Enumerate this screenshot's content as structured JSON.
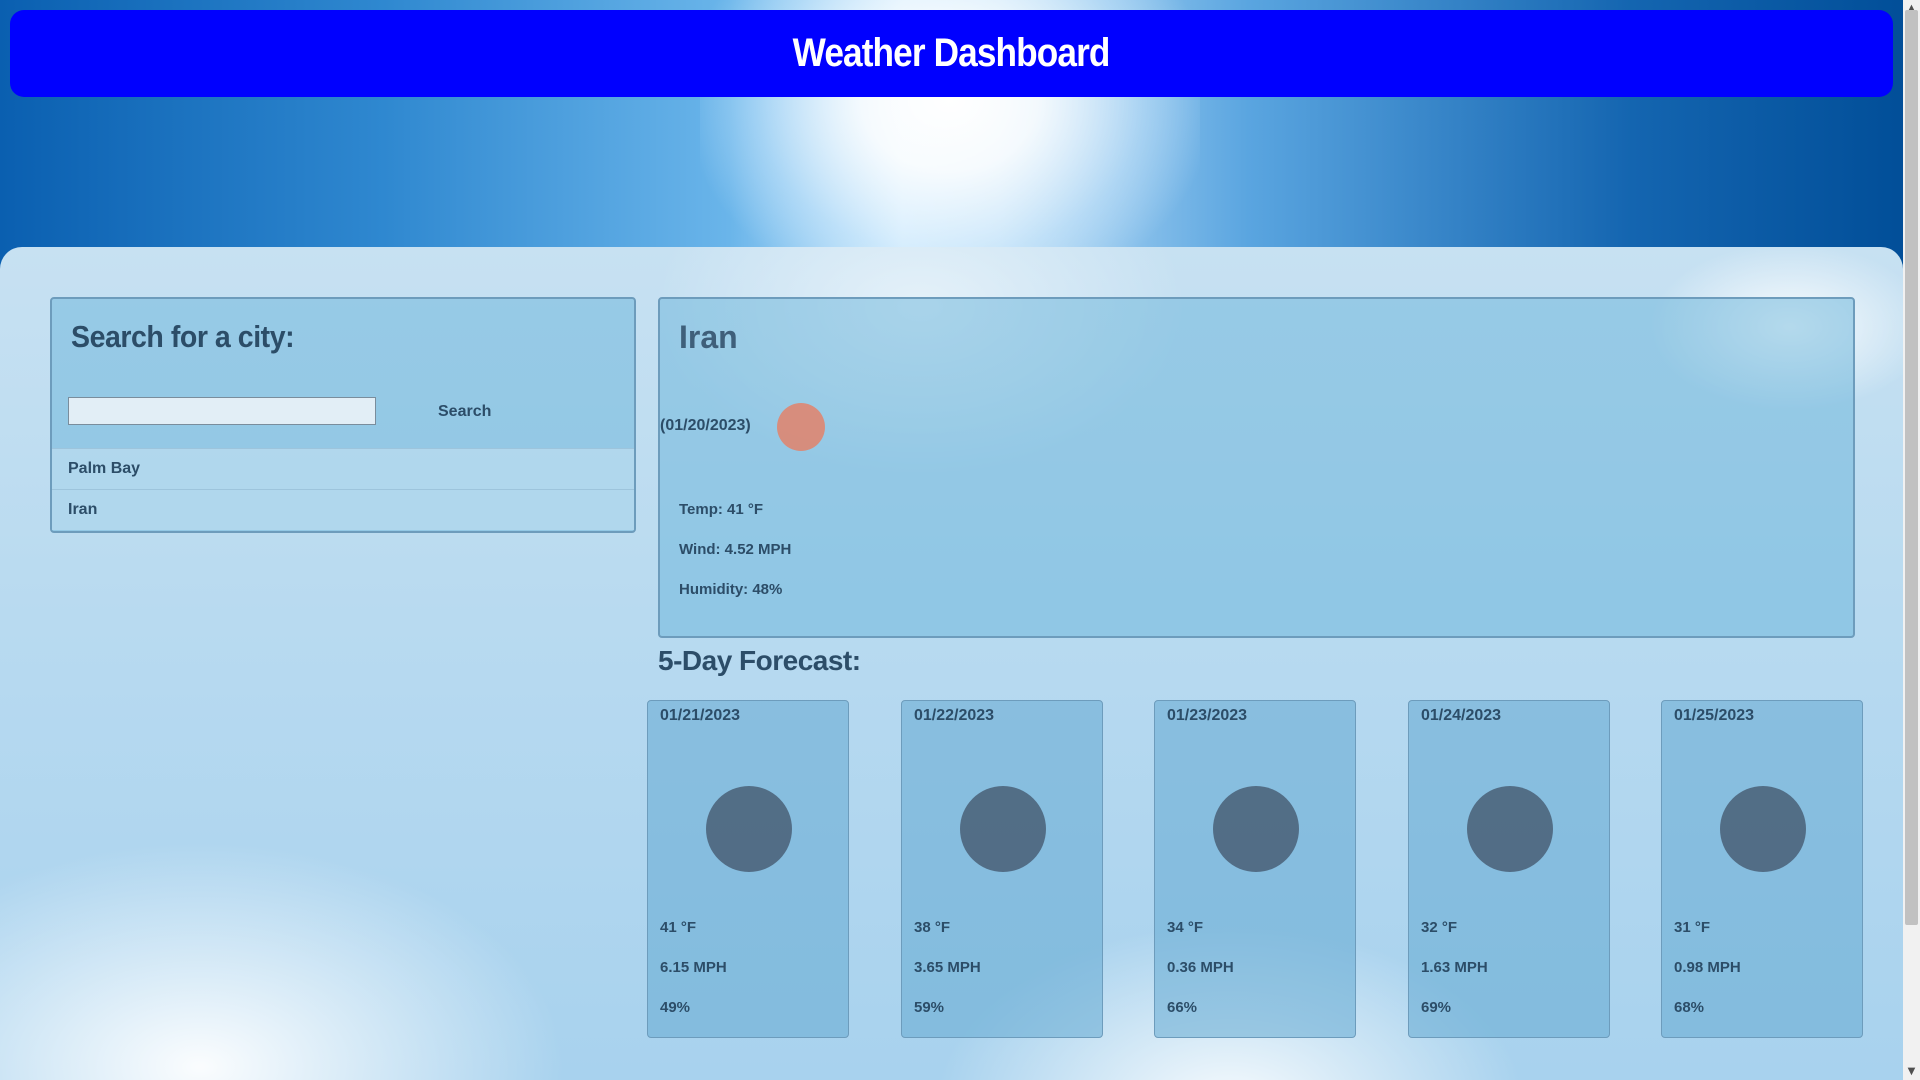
{
  "header": {
    "title": "Weather Dashboard"
  },
  "search": {
    "title": "Search for a city:",
    "input_value": "",
    "button_label": "Search",
    "history": [
      "Palm Bay",
      "Iran"
    ]
  },
  "current": {
    "city": "Iran",
    "date": "(01/20/2023)",
    "icon": "weather-icon",
    "temp": "Temp: 41 °F",
    "wind": "Wind: 4.52 MPH",
    "humidity": "Humidity: 48%"
  },
  "forecast": {
    "title": "5-Day Forecast:",
    "days": [
      {
        "date": "01/21/2023",
        "temp": "41 °F",
        "wind": "6.15 MPH",
        "humidity": "49%"
      },
      {
        "date": "01/22/2023",
        "temp": "38 °F",
        "wind": "3.65 MPH",
        "humidity": "59%"
      },
      {
        "date": "01/23/2023",
        "temp": "34 °F",
        "wind": "0.36 MPH",
        "humidity": "66%"
      },
      {
        "date": "01/24/2023",
        "temp": "32 °F",
        "wind": "1.63 MPH",
        "humidity": "69%"
      },
      {
        "date": "01/25/2023",
        "temp": "31 °F",
        "wind": "0.98 MPH",
        "humidity": "68%"
      }
    ]
  },
  "colors": {
    "header_bg": "#0000ff",
    "text": "#2c4d68"
  }
}
